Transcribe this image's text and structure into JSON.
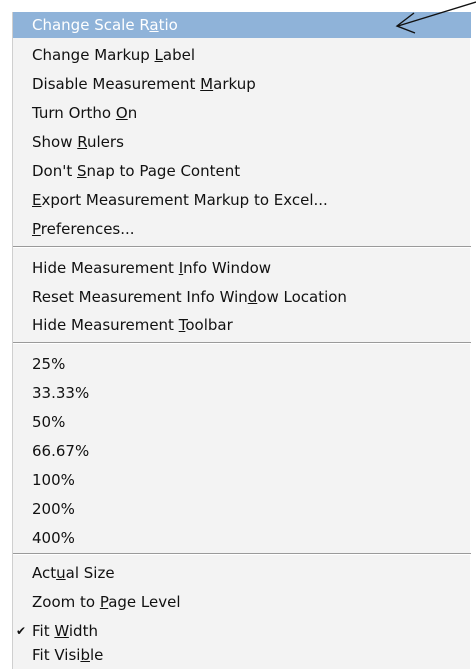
{
  "menu": {
    "items": [
      {
        "pre": "Change Scale R",
        "acc": "a",
        "post": "tio"
      },
      {
        "pre": "Change Markup ",
        "acc": "L",
        "post": "abel"
      },
      {
        "pre": "Disable Measurement ",
        "acc": "M",
        "post": "arkup"
      },
      {
        "pre": "Turn Ortho ",
        "acc": "O",
        "post": "n"
      },
      {
        "pre": "Show ",
        "acc": "R",
        "post": "ulers"
      },
      {
        "pre": "Don't ",
        "acc": "S",
        "post": "nap to Page Content"
      },
      {
        "pre": "",
        "acc": "E",
        "post": "xport Measurement Markup to Excel..."
      },
      {
        "pre": "",
        "acc": "P",
        "post": "references..."
      },
      {
        "pre": "Hide Measurement ",
        "acc": "I",
        "post": "nfo Window"
      },
      {
        "pre": "Reset Measurement Info Win",
        "acc": "d",
        "post": "ow Location"
      },
      {
        "pre": "Hide Measurement ",
        "acc": "T",
        "post": "oolbar"
      },
      {
        "pre": "25%",
        "acc": "",
        "post": ""
      },
      {
        "pre": "33.33%",
        "acc": "",
        "post": ""
      },
      {
        "pre": "50%",
        "acc": "",
        "post": ""
      },
      {
        "pre": "66.67%",
        "acc": "",
        "post": ""
      },
      {
        "pre": "100%",
        "acc": "",
        "post": ""
      },
      {
        "pre": "200%",
        "acc": "",
        "post": ""
      },
      {
        "pre": "400%",
        "acc": "",
        "post": ""
      },
      {
        "pre": "Act",
        "acc": "u",
        "post": "al Size"
      },
      {
        "pre": "Zoom to ",
        "acc": "P",
        "post": "age Level"
      },
      {
        "pre": "Fit ",
        "acc": "W",
        "post": "idth"
      },
      {
        "pre": "Fit Visi",
        "acc": "b",
        "post": "le"
      }
    ],
    "check_glyph": "✔",
    "highlight_color": "#8fb3d9",
    "checked_item": "Fit Width",
    "highlighted_item": "Change Scale Ratio"
  }
}
